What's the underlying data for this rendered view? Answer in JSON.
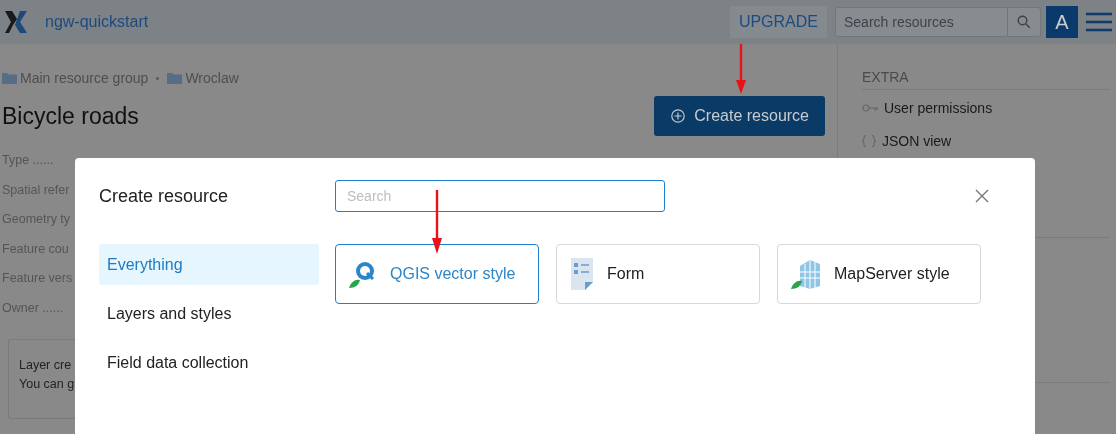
{
  "header": {
    "title": "ngw-quickstart",
    "upgrade": "UPGRADE",
    "search": {
      "placeholder": "Search resources"
    },
    "avatar": "A"
  },
  "breadcrumbs": [
    "Main resource group",
    "Wroclaw"
  ],
  "page_title": "Bicycle roads",
  "create_button": {
    "label": "Create resource",
    "pointed": true
  },
  "properties": [
    "Type ......",
    "Spatial refer",
    "Geometry ty",
    "Feature cou",
    "Feature vers",
    "Owner ......"
  ],
  "notice": [
    "Layer cre",
    "You can g"
  ],
  "sidebar": {
    "heading": "EXTRA",
    "items": [
      {
        "kind": "key",
        "label": "User permissions"
      },
      {
        "kind": "braces",
        "label": "JSON view"
      }
    ]
  },
  "dialog": {
    "title": "Create resource",
    "search": {
      "placeholder": "Search"
    },
    "categories": [
      {
        "label": "Everything",
        "selected": true
      },
      {
        "label": "Layers and styles",
        "selected": false
      },
      {
        "label": "Field data collection",
        "selected": false
      }
    ],
    "cards": [
      {
        "kind": "qgis",
        "label": "QGIS vector style",
        "selected": true,
        "pointed": true
      },
      {
        "kind": "form",
        "label": "Form",
        "selected": false,
        "pointed": false
      },
      {
        "kind": "mapserver",
        "label": "MapServer style",
        "selected": false,
        "pointed": false
      }
    ]
  }
}
